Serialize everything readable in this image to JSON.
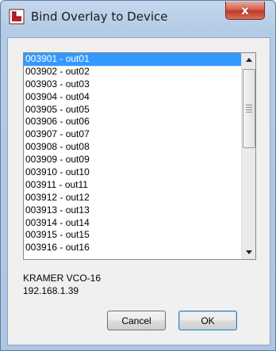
{
  "window": {
    "title": "Bind Overlay to Device",
    "close_label": "x",
    "accent_color": "#3399ff"
  },
  "list": {
    "selected_index": 0,
    "items": [
      "003901 - out01",
      "003902 - out02",
      "003903 - out03",
      "003904 - out04",
      "003905 - out05",
      "003906 - out06",
      "003907 - out07",
      "003908 - out08",
      "003909 - out09",
      "003910 - out10",
      "003911 - out11",
      "003912 - out12",
      "003913 - out13",
      "003914 - out14",
      "003915 - out15",
      "003916 - out16"
    ]
  },
  "device": {
    "name": "KRAMER VCO-16",
    "ip": "192.168.1.39"
  },
  "buttons": {
    "cancel_label": "Cancel",
    "ok_label": "OK"
  }
}
